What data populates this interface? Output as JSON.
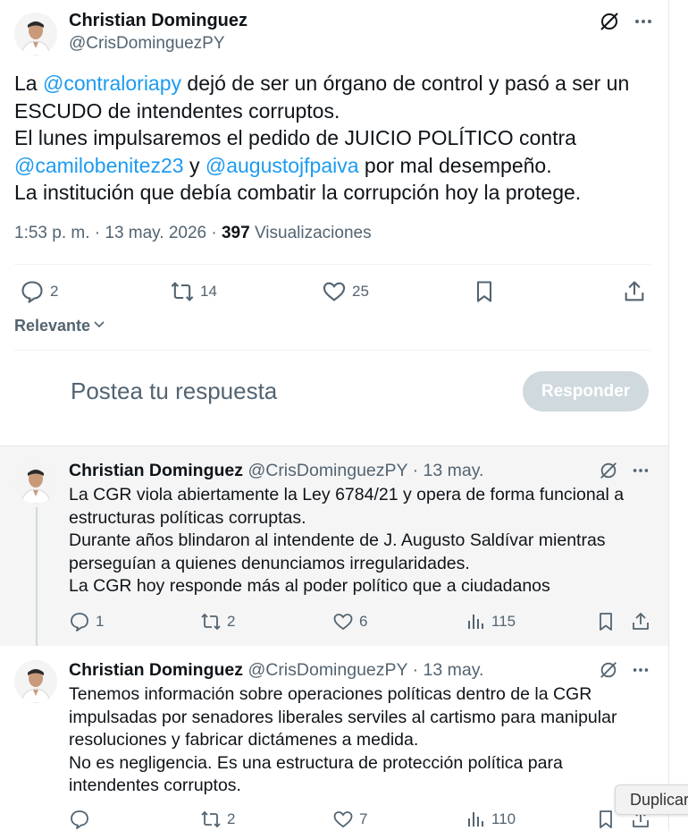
{
  "colors": {
    "accent": "#1d9bf0",
    "muted": "#536471",
    "text": "#0f1419",
    "reply_button_bg": "#cfd9de"
  },
  "main_tweet": {
    "name": "Christian Dominguez",
    "handle": "@CrisDominguezPY",
    "lines": [
      {
        "pre": "La ",
        "mention": "@contraloriapy",
        "post": " dejó de ser un órgano de control y pasó a ser un"
      },
      {
        "text": "ESCUDO de intendentes corruptos."
      },
      {
        "text": "El lunes impulsaremos el pedido de JUICIO POLÍTICO contra"
      },
      {
        "mention1": "@camilobenitez23",
        "mid": " y ",
        "mention2": "@augustojfpaiva",
        "post": " por mal desempeño."
      },
      {
        "text": "La institución que debía combatir la corrupción hoy la protege."
      }
    ],
    "timestamp": "1:53 p. m. · 13 may. 2026 · ",
    "views_count": "397",
    "views_label": " Visualizaciones",
    "replies": "2",
    "retweets": "14",
    "likes": "25",
    "icons": [
      "grok-icon",
      "more-icon",
      "reply-icon",
      "retweet-icon",
      "like-icon",
      "bookmark-icon",
      "share-icon"
    ]
  },
  "sort": {
    "label": "Relevante"
  },
  "composer": {
    "placeholder": "Postea tu respuesta",
    "button": "Responder"
  },
  "replies": [
    {
      "name": "Christian Dominguez",
      "handle": "@CrisDominguezPY",
      "date": " · 13 may.",
      "lines": [
        "La CGR viola abiertamente la Ley 6784/21 y opera de forma funcional a",
        "estructuras políticas corruptas.",
        "Durante años blindaron al intendente de J. Augusto Saldívar mientras",
        "perseguían a quienes denunciamos irregularidades.",
        "La CGR hoy responde más al poder político que a ciudadanos"
      ],
      "replies": "1",
      "retweets": "2",
      "likes": "6",
      "views": "115"
    },
    {
      "name": "Christian Dominguez",
      "handle": "@CrisDominguezPY",
      "date": " · 13 may.",
      "lines": [
        "Tenemos información sobre operaciones políticas dentro de la CGR",
        "impulsadas por senadores liberales serviles al cartismo para manipular",
        "resoluciones y fabricar dictámenes a medida.",
        "No es negligencia. Es una estructura de protección política para",
        "intendentes corruptos."
      ],
      "replies": "",
      "retweets": "2",
      "likes": "7",
      "views": "110"
    }
  ],
  "tooltip": {
    "text": "Duplicar"
  }
}
